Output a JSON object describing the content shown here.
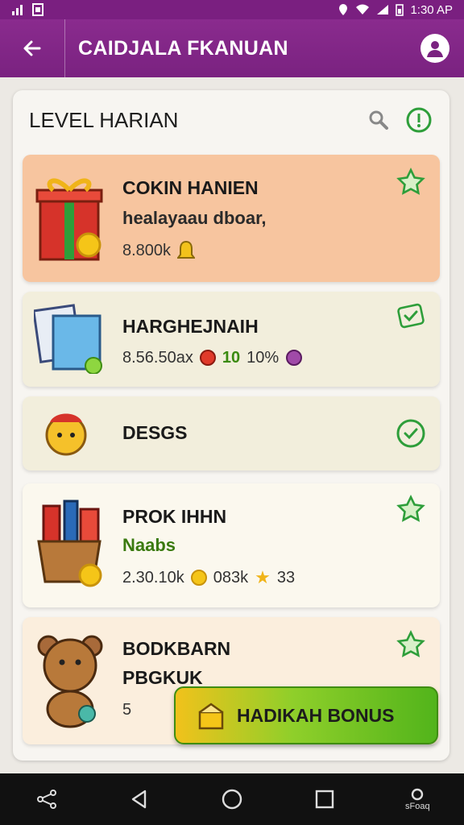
{
  "status_bar": {
    "time": "1:30 AP"
  },
  "app_bar": {
    "title": "CAIDJALA FKANUAN"
  },
  "panel": {
    "title": "LEVEL HARIAN"
  },
  "cards": [
    {
      "name": "COKIN HANIEN",
      "sub": "healayaau dboar,",
      "meta": "8.800k"
    },
    {
      "name": "HARGHEJNAIH",
      "meta": "8.56.50ax",
      "meta2": "10",
      "meta3": "10%"
    },
    {
      "name": "DESGS"
    },
    {
      "name": "PROK IHHN",
      "sub": "Naabs",
      "meta": "2.30.10k",
      "meta2": "083k",
      "meta3": "33"
    },
    {
      "name": "BODKBARN",
      "sub": "PBGKUK",
      "meta": "5"
    }
  ],
  "bonus_button": {
    "label": "HADIKAH BONUS"
  },
  "nav_bar": {
    "extra_label": "sFoaq"
  },
  "colors": {
    "appbar": "#7a2280",
    "card1": "#f7c59f",
    "accent_green": "#2e9e3a",
    "bonus_start": "#f1c21b",
    "bonus_end": "#52b41b"
  }
}
